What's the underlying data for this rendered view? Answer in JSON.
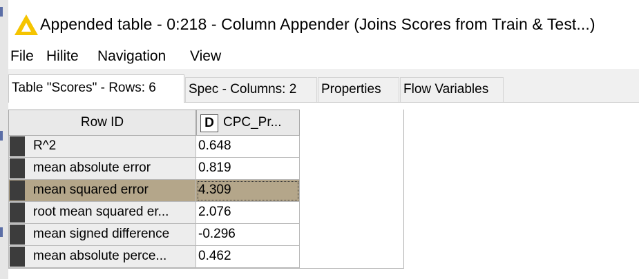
{
  "window": {
    "title": "Appended table - 0:218 - Column Appender (Joins Scores from Train & Test...)",
    "accent_color": "#f5c400"
  },
  "menu": {
    "items": [
      "File",
      "Hilite",
      "Navigation",
      "View"
    ]
  },
  "tabs": [
    {
      "label": "Table \"Scores\" - Rows: 6",
      "active": true
    },
    {
      "label": "Spec - Columns: 2",
      "active": false
    },
    {
      "label": "Properties",
      "active": false
    },
    {
      "label": "Flow Variables",
      "active": false
    }
  ],
  "table": {
    "row_id_header": "Row ID",
    "column": {
      "type_badge": "D",
      "name": "CPC_Pr..."
    },
    "selected_color": "#b4a68a",
    "rows": [
      {
        "row_id": "R^2",
        "value": "0.648",
        "selected": false
      },
      {
        "row_id": "mean absolute error",
        "value": "0.819",
        "selected": false
      },
      {
        "row_id": "mean squared error",
        "value": "4.309",
        "selected": true
      },
      {
        "row_id": "root mean squared er...",
        "value": "2.076",
        "selected": false
      },
      {
        "row_id": "mean signed difference",
        "value": "-0.296",
        "selected": false
      },
      {
        "row_id": "mean absolute perce...",
        "value": "0.462",
        "selected": false
      }
    ]
  }
}
